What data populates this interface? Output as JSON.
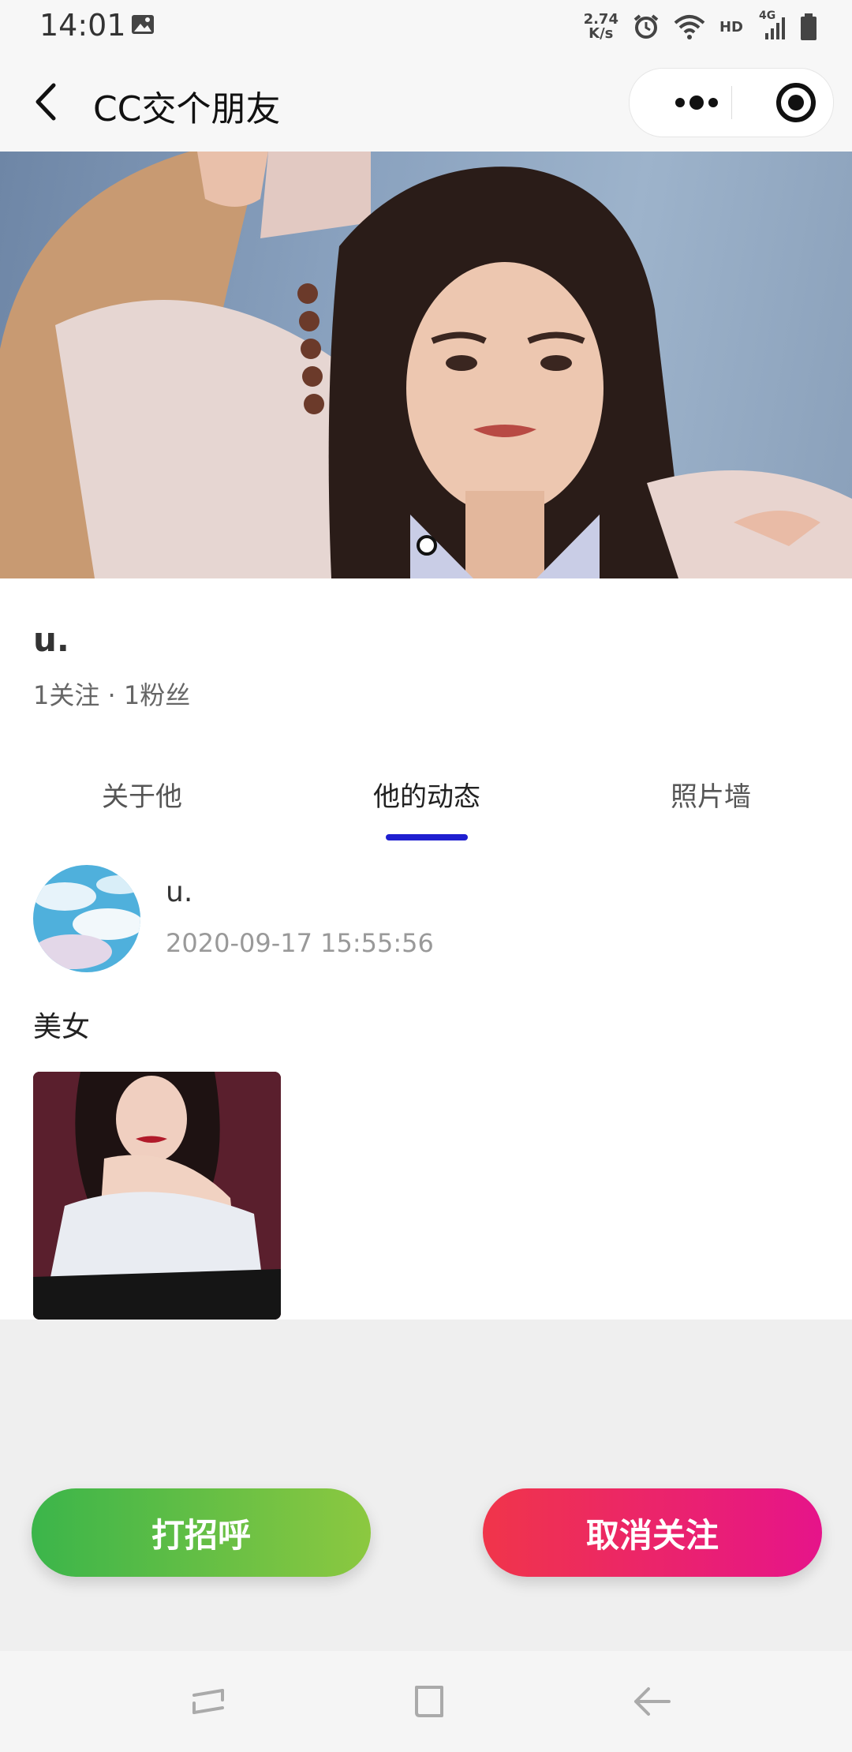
{
  "status_bar": {
    "time": "14:01",
    "speed": "2.74",
    "speed_unit": "K/s",
    "hd": "HD",
    "network": "4G",
    "icons": [
      "image-icon",
      "alarm-icon",
      "wifi-icon",
      "signal-icon",
      "battery-icon"
    ]
  },
  "header": {
    "title": "CC交个朋友",
    "icons": [
      "back-icon",
      "more-icon",
      "target-icon"
    ]
  },
  "profile": {
    "username": "u.",
    "stats": "1关注 · 1粉丝"
  },
  "tabs": [
    {
      "label": "关于他",
      "active": false
    },
    {
      "label": "他的动态",
      "active": true
    },
    {
      "label": "照片墙",
      "active": false
    }
  ],
  "post": {
    "author": "u.",
    "timestamp": "2020-09-17 15:55:56",
    "text": "美女"
  },
  "actions": {
    "greet_label": "打招呼",
    "unfollow_label": "取消关注"
  },
  "colors": {
    "tab_indicator": "#1f1fd0",
    "greet_start": "#3bb54a",
    "greet_end": "#8cc840",
    "unfollow_start": "#f0354a",
    "unfollow_end": "#e6148a"
  }
}
